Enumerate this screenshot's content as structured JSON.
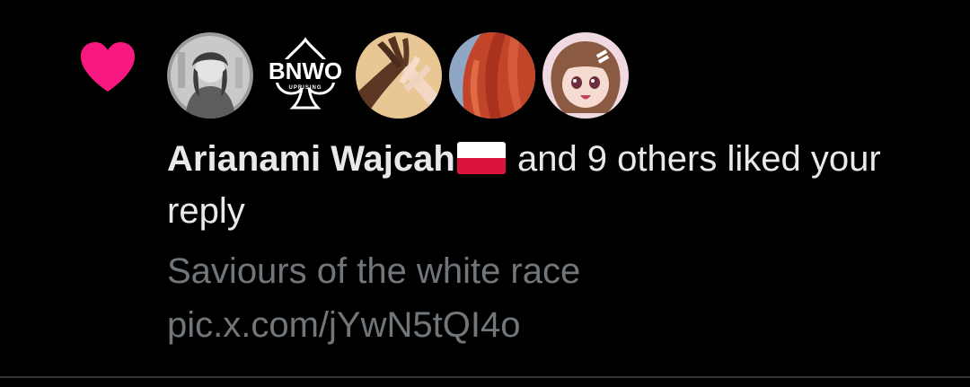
{
  "notification": {
    "type_icon": "heart-icon",
    "actor_name": "Arianami Wajcah",
    "actor_flag": "poland-flag-icon",
    "action_text": " and 9 others liked your reply",
    "reply_text": "Saviours of the white race pic.x.com/jYwN5tQI4o",
    "avatars": [
      {
        "name": "avatar-1",
        "style": "grayscale-portrait"
      },
      {
        "name": "avatar-2",
        "style": "bnwo-logo",
        "logo_text": "BNWO",
        "logo_subtext": "UPRISING"
      },
      {
        "name": "avatar-3",
        "style": "hands-photo"
      },
      {
        "name": "avatar-4",
        "style": "red-hair-photo"
      },
      {
        "name": "avatar-5",
        "style": "anime-portrait"
      }
    ]
  },
  "colors": {
    "background": "#000000",
    "like": "#f91880",
    "primary_text": "#e7e9ea",
    "secondary_text": "#71767b",
    "divider": "#2f3336",
    "flag_red": "#dc143c"
  }
}
